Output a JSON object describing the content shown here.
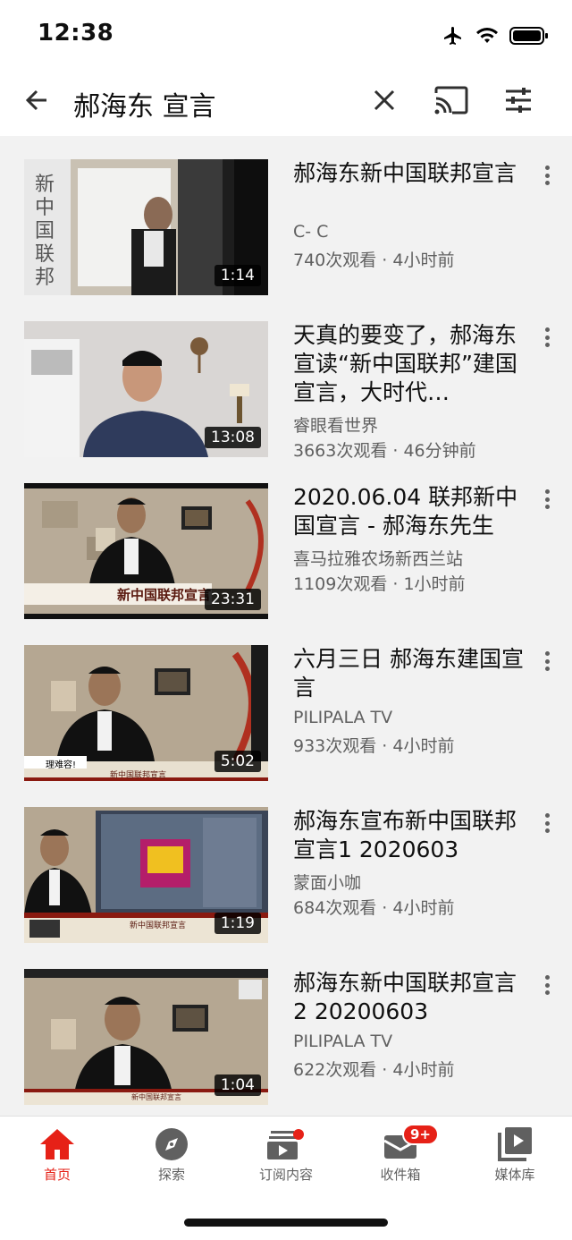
{
  "status": {
    "time": "12:38"
  },
  "search": {
    "query": "郝海东 宣言"
  },
  "results": [
    {
      "title": "郝海东新中国联邦宣言",
      "channel": "C- C",
      "meta": "740次观看 · 4小时前",
      "duration": "1:14"
    },
    {
      "title": "天真的要变了，郝海东宣读“新中国联邦”建国宣言，大时代…",
      "channel": "睿眼看世界",
      "meta": "3663次观看 · 46分钟前",
      "duration": "13:08"
    },
    {
      "title": "2020.06.04 联邦新中国宣言 - 郝海东先生",
      "channel": "喜马拉雅农场新西兰站",
      "meta": "1109次观看 · 1小时前",
      "duration": "23:31"
    },
    {
      "title": "六月三日 郝海东建国宣言",
      "channel": "PILIPALA TV",
      "meta": "933次观看 · 4小时前",
      "duration": "5:02"
    },
    {
      "title": "郝海东宣布新中国联邦宣言1 2020603",
      "channel": "蒙面小咖",
      "meta": "684次观看 · 4小时前",
      "duration": "1:19"
    },
    {
      "title": "郝海东新中国联邦宣言2 20200603",
      "channel": "PILIPALA TV",
      "meta": "622次观看 · 4小时前",
      "duration": "1:04"
    }
  ],
  "thumb_text": {
    "t1": "新中国联邦",
    "t3": "新中国联邦宣言",
    "t4_caption": "理难容!",
    "t4_banner": "新中国联邦宣言",
    "t5_banner": "新中国联邦宣言",
    "t6_banner": "新中国联邦宣言"
  },
  "nav": {
    "home": "首页",
    "explore": "探索",
    "subscriptions": "订阅内容",
    "inbox": "收件箱",
    "inbox_badge": "9+",
    "library": "媒体库"
  },
  "colors": {
    "accent": "#e62117",
    "bg_results": "#f2f2f2"
  }
}
